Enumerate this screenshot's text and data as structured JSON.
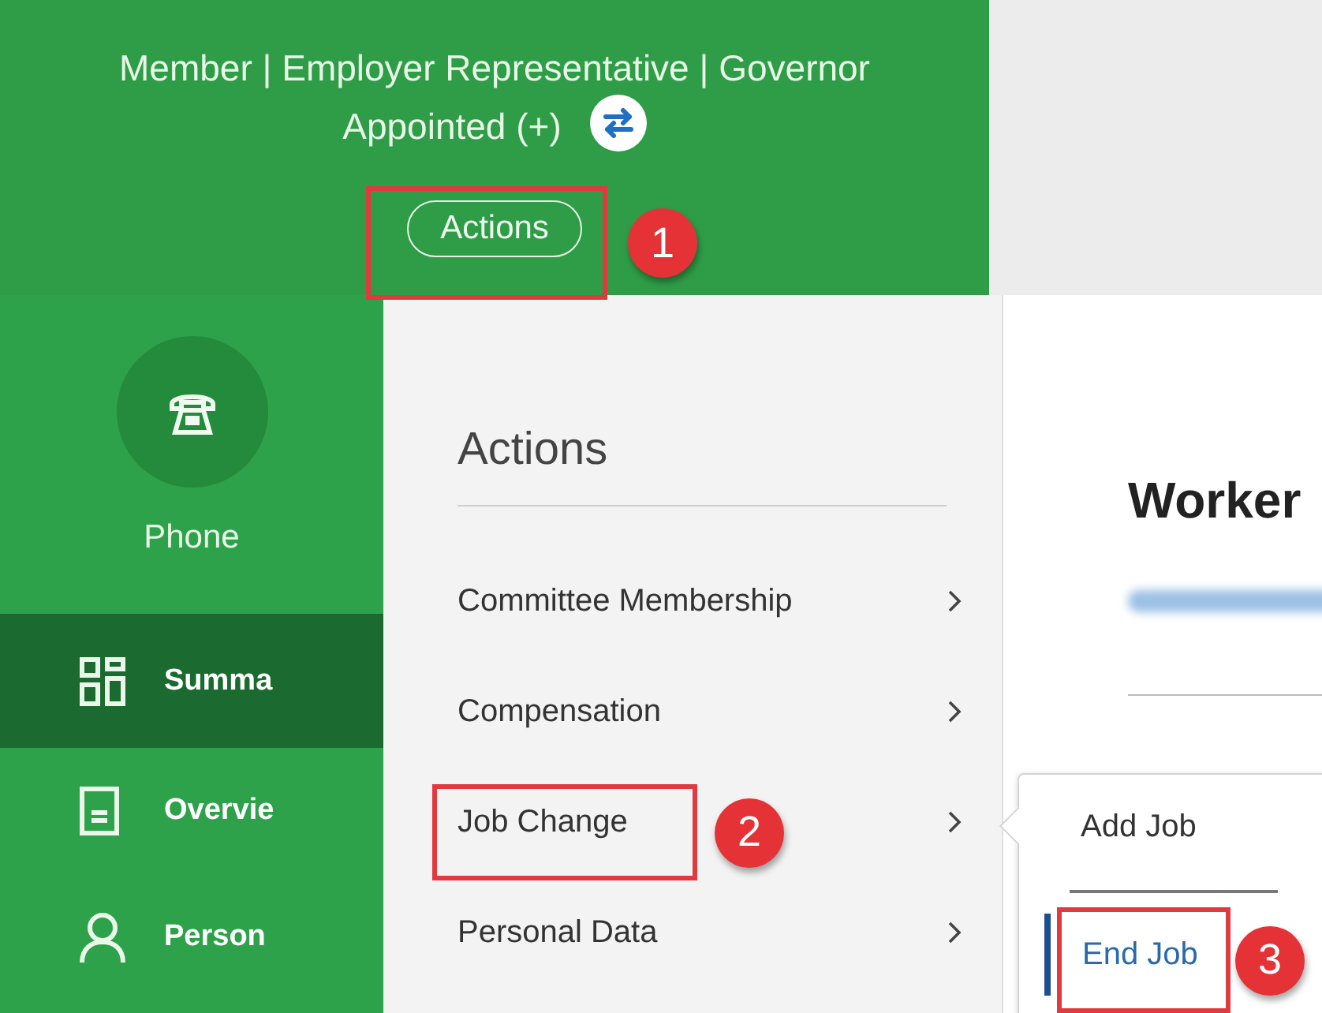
{
  "header": {
    "role_lines": [
      "Member | Employer Representative | Governor",
      "Appointed (+)"
    ],
    "actions_button": "Actions"
  },
  "sidebar": {
    "contact": {
      "label": "Phone"
    },
    "items": [
      {
        "label": "Summa",
        "selected": true
      },
      {
        "label": "Overvie",
        "selected": false
      },
      {
        "label": "Person",
        "selected": false
      }
    ]
  },
  "actions_menu": {
    "title": "Actions",
    "items": [
      {
        "label": "Committee Membership",
        "has_submenu": true
      },
      {
        "label": "Compensation",
        "has_submenu": true
      },
      {
        "label": "Job Change",
        "has_submenu": true
      },
      {
        "label": "Personal Data",
        "has_submenu": true
      }
    ]
  },
  "content": {
    "title": "Worker"
  },
  "submenu": {
    "items": [
      {
        "label": "Add Job",
        "selected": false
      },
      {
        "label": "End Job",
        "selected": true
      }
    ]
  },
  "annotations": [
    {
      "number": "1"
    },
    {
      "number": "2"
    },
    {
      "number": "3"
    }
  ]
}
